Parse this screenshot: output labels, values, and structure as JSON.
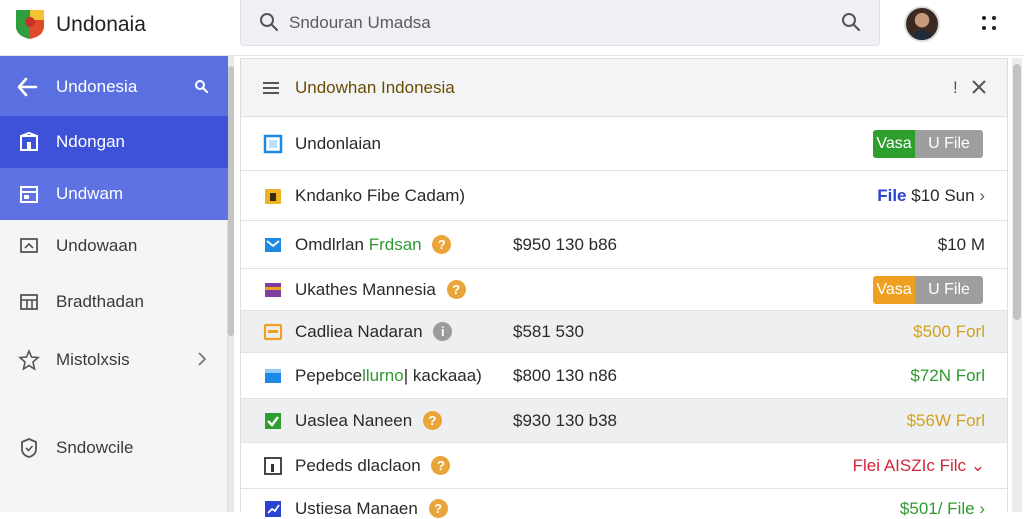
{
  "app": {
    "title": "Undonaia"
  },
  "search": {
    "placeholder": "Sndouran Umadsa"
  },
  "sidebar": {
    "header": "Undonesia",
    "items": [
      {
        "label": "Ndongan",
        "icon": "building-icon"
      },
      {
        "label": "Undwam",
        "icon": "calendar-icon"
      },
      {
        "label": "Undowaan",
        "icon": "monitor-icon"
      },
      {
        "label": "Bradthadan",
        "icon": "grid-icon"
      },
      {
        "label": "Mistolxsis",
        "icon": "star-icon"
      },
      {
        "label": "Sndowcile",
        "icon": "shield-icon"
      }
    ]
  },
  "panel": {
    "title": "Undowhan Indonesia",
    "extra": "!",
    "rows": [
      {
        "icon": "square-icon",
        "icon_color": "#1e88e5",
        "name": "Undonlaian",
        "pill": {
          "left": "Vasa",
          "right": "U File",
          "color": "#2e9e2e"
        }
      },
      {
        "icon": "folder-icon",
        "icon_color": "#f0b323",
        "name": "Kndanko Fibe Cadam)",
        "right_a": "File",
        "right_b": "$10 Sun",
        "right_a_color": "#2b43d1"
      },
      {
        "icon": "mail-icon",
        "icon_color": "#1e88e5",
        "name": "Omdlrlan",
        "name_green": "Frdsan",
        "badge": "?",
        "amount": "$950 130 b86",
        "right_b": "$10 M"
      },
      {
        "icon": "card-icon",
        "icon_color": "#7b3fa0",
        "name": "Ukathes Mannesia",
        "badge": "?",
        "pill": {
          "left": "Vasa",
          "right": "U File",
          "color": "#f0a020"
        }
      },
      {
        "icon": "folder-icon",
        "icon_color": "#f0a020",
        "name": "Cadliea Nadaran",
        "badge": "i",
        "badge_grey": true,
        "amount": "$581 530",
        "right_b": "$500 Forl",
        "right_color": "#d1a21b"
      },
      {
        "icon": "tablet-icon",
        "icon_color": "#1e88e5",
        "name": "Pepebce",
        "name_green": "llurno",
        "name_tail": "| kackaaa)",
        "amount": "$800 130 n86",
        "right_b": "$72N Forl",
        "right_color": "#2f9a2f"
      },
      {
        "icon": "check-icon",
        "icon_color": "#2e9e2e",
        "name": "Uaslea Naneen",
        "badge": "?",
        "amount": "$930 130 b38",
        "right_b": "$56W Forl",
        "right_color": "#d1a21b"
      },
      {
        "icon": "doc-icon",
        "icon_color": "#333333",
        "name": "Pededs dlaclaon",
        "badge": "?",
        "right_a": "Flei AISZIc",
        "right_b": "Filc",
        "right_color": "#d0263a",
        "right_a_color": "#d0263a"
      },
      {
        "icon": "chart-icon",
        "icon_color": "#2b43d1",
        "name": "Ustiesa Manaen",
        "badge": "?",
        "right_b": "$501/ File",
        "right_color": "#2f9a2f"
      }
    ]
  }
}
